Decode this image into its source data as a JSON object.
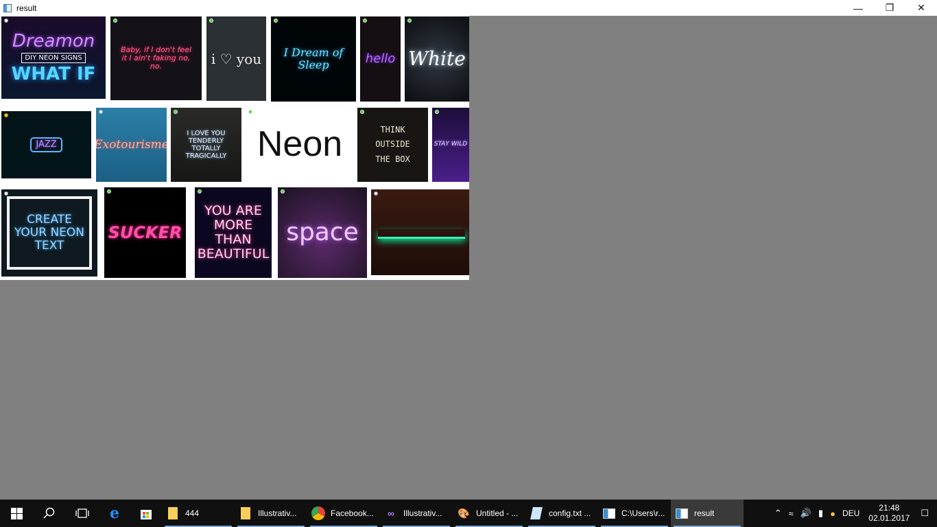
{
  "window": {
    "title": "result"
  },
  "tiles": [
    {
      "line1": "Dreamon",
      "line2": "DIY NEON SIGNS",
      "line3": "WHAT IF"
    },
    {
      "text": "Baby, if I don't feel it I ain't faking no, no."
    },
    {
      "text": "i ♡ you"
    },
    {
      "text": "I Dream of Sleep"
    },
    {
      "text": "hello"
    },
    {
      "text": "White"
    },
    {
      "text": "JAZZ"
    },
    {
      "text": "Exotourisme"
    },
    {
      "text": "I LOVE YOU TENDERLY TOTALLY TRAGICALLY"
    },
    {
      "text": "Neon"
    },
    {
      "text": "THINK OUTSIDE THE BOX"
    },
    {
      "text": "STAY WILD"
    },
    {
      "text": "CREATE YOUR NEON TEXT"
    },
    {
      "text": "SUCKER"
    },
    {
      "text": "YOU ARE MORE THAN BEAUTIFUL"
    },
    {
      "text": "space"
    },
    {
      "text": ""
    }
  ],
  "taskbar": {
    "apps": [
      {
        "label": "444",
        "icon": "folder-icon"
      },
      {
        "label": "Illustrativ...",
        "icon": "folder-icon"
      },
      {
        "label": "Facebook...",
        "icon": "chrome-icon"
      },
      {
        "label": "Illustrativ...",
        "icon": "visual-studio-icon"
      },
      {
        "label": "Untitled - ...",
        "icon": "paint-icon"
      },
      {
        "label": "config.txt ...",
        "icon": "notepad-icon"
      },
      {
        "label": "C:\\Users\\r...",
        "icon": "window-icon"
      },
      {
        "label": "result",
        "icon": "window-icon"
      }
    ],
    "language": "DEU",
    "time": "21:48",
    "date": "02.01.2017"
  }
}
